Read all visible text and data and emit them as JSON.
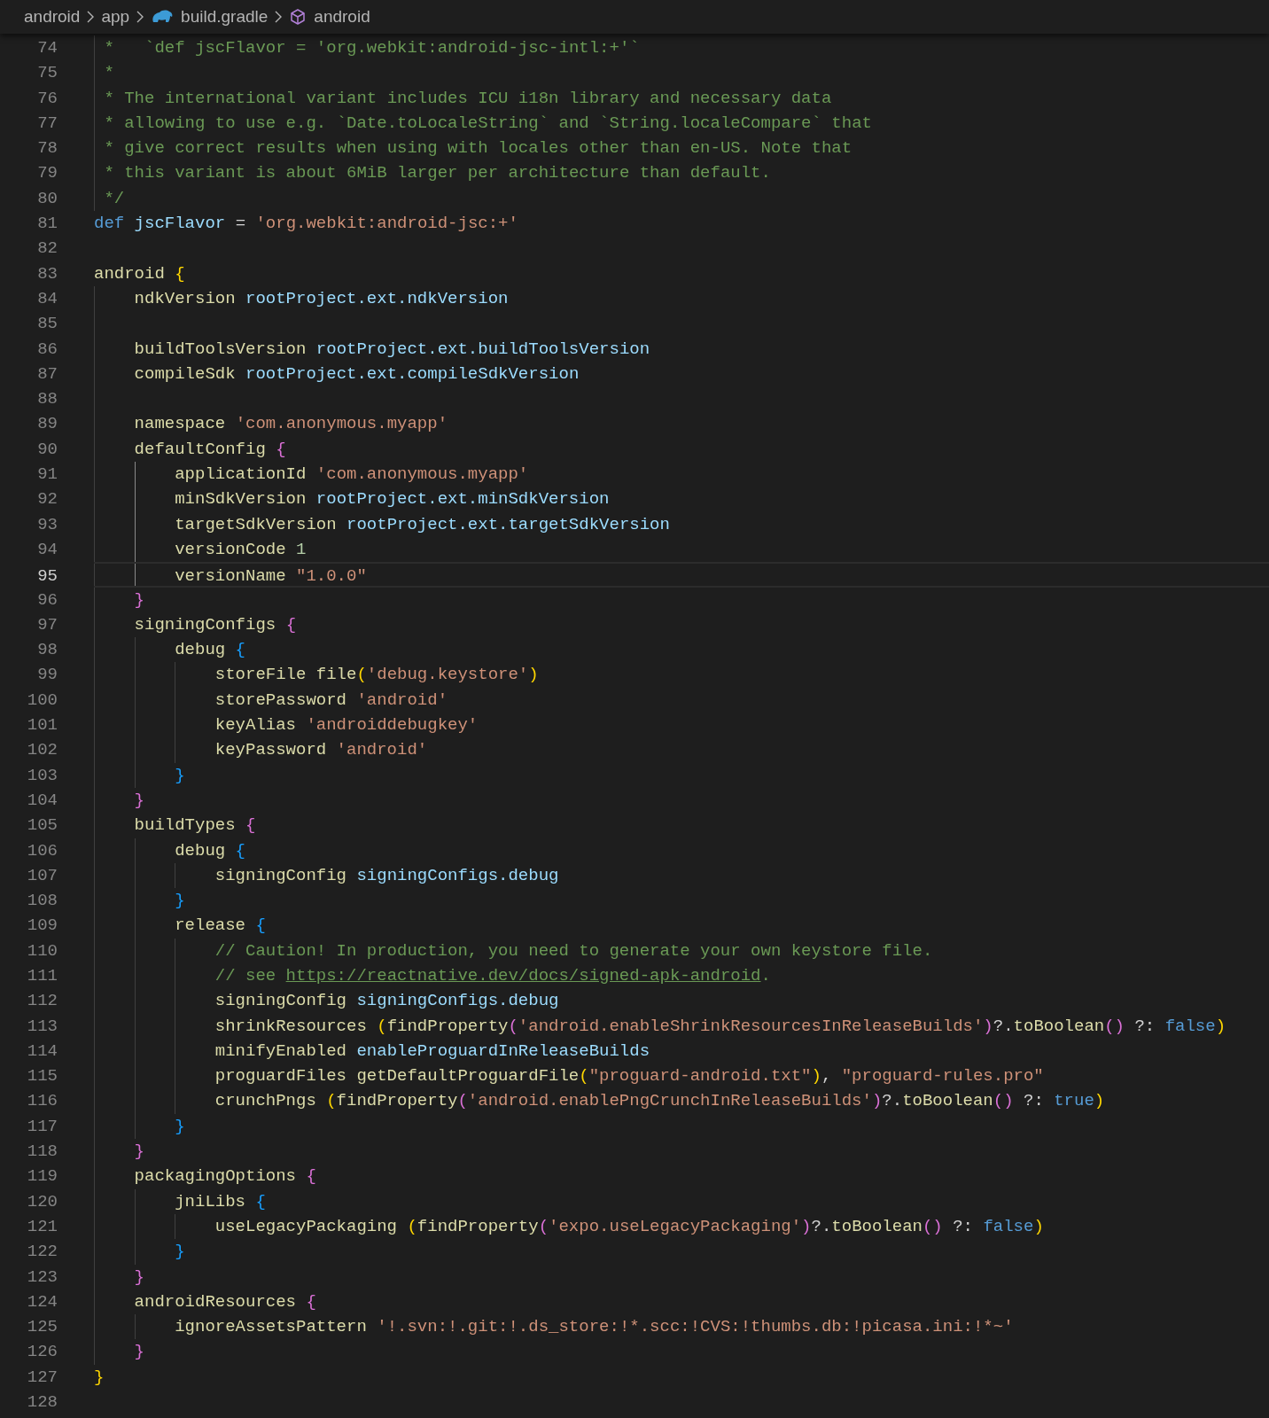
{
  "breadcrumb": [
    {
      "text": "android",
      "kind": "folder"
    },
    {
      "text": "app",
      "kind": "folder"
    },
    {
      "text": "build.gradle",
      "kind": "file"
    },
    {
      "text": "android",
      "kind": "symbol"
    }
  ],
  "lines": [
    {
      "number": "74",
      "kind": "doc",
      "guides": [
        false
      ],
      "current": false,
      "tokens": [
        {
          "kind": "cmt",
          "text": "*   `def jscFlavor = 'org.webkit:android-jsc-intl:+'`"
        }
      ]
    },
    {
      "number": "75",
      "kind": "doc",
      "guides": [
        false
      ],
      "current": false,
      "tokens": [
        {
          "kind": "cmt",
          "text": "*"
        }
      ]
    },
    {
      "number": "76",
      "kind": "doc",
      "guides": [
        false
      ],
      "current": false,
      "tokens": [
        {
          "kind": "cmt",
          "text": "* The international variant includes ICU i18n library and necessary data"
        }
      ]
    },
    {
      "number": "77",
      "kind": "doc",
      "guides": [
        false
      ],
      "current": false,
      "tokens": [
        {
          "kind": "cmt",
          "text": "* allowing to use e.g. `Date.toLocaleString` and `String.localeCompare` that"
        }
      ]
    },
    {
      "number": "78",
      "kind": "doc",
      "guides": [
        false
      ],
      "current": false,
      "tokens": [
        {
          "kind": "cmt",
          "text": "* give correct results when using with locales other than en-US. Note that"
        }
      ]
    },
    {
      "number": "79",
      "kind": "doc",
      "guides": [
        false
      ],
      "current": false,
      "tokens": [
        {
          "kind": "cmt",
          "text": "* this variant is about 6MiB larger per architecture than default."
        }
      ]
    },
    {
      "number": "80",
      "kind": "doc",
      "guides": [
        false
      ],
      "current": false,
      "tokens": [
        {
          "kind": "cmt",
          "text": "*/"
        }
      ]
    },
    {
      "number": "81",
      "kind": "code",
      "current": false,
      "tokens": [
        {
          "kind": "kw",
          "text": "def "
        },
        {
          "kind": "var",
          "text": "jscFlavor"
        },
        {
          "kind": "plain",
          "text": " = "
        },
        {
          "kind": "str",
          "text": "'org.webkit:android-jsc:+'"
        }
      ]
    },
    {
      "number": "82",
      "kind": "code",
      "current": false
    },
    {
      "number": "83",
      "kind": "code",
      "current": false,
      "tokens": [
        {
          "kind": "fn",
          "text": "android "
        },
        {
          "kind": "b0",
          "text": "{"
        }
      ]
    },
    {
      "number": "84",
      "kind": "code",
      "guides": [
        false
      ],
      "current": false,
      "tokens": [
        {
          "kind": "fn",
          "text": "ndkVersion "
        },
        {
          "kind": "var",
          "text": "rootProject.ext.ndkVersion"
        }
      ]
    },
    {
      "number": "85",
      "kind": "code",
      "guides": [
        false
      ],
      "current": false
    },
    {
      "number": "86",
      "kind": "code",
      "guides": [
        false
      ],
      "current": false,
      "tokens": [
        {
          "kind": "fn",
          "text": "buildToolsVersion "
        },
        {
          "kind": "var",
          "text": "rootProject.ext.buildToolsVersion"
        }
      ]
    },
    {
      "number": "87",
      "kind": "code",
      "guides": [
        false
      ],
      "current": false,
      "tokens": [
        {
          "kind": "fn",
          "text": "compileSdk "
        },
        {
          "kind": "var",
          "text": "rootProject.ext.compileSdkVersion"
        }
      ]
    },
    {
      "number": "88",
      "kind": "code",
      "guides": [
        false
      ],
      "current": false
    },
    {
      "number": "89",
      "kind": "code",
      "guides": [
        false
      ],
      "current": false,
      "tokens": [
        {
          "kind": "fn",
          "text": "namespace "
        },
        {
          "kind": "str",
          "text": "'com.anonymous.myapp'"
        }
      ]
    },
    {
      "number": "90",
      "kind": "code",
      "guides": [
        false
      ],
      "current": false,
      "tokens": [
        {
          "kind": "fn",
          "text": "defaultConfig "
        },
        {
          "kind": "b1",
          "text": "{"
        }
      ]
    },
    {
      "number": "91",
      "kind": "code",
      "guides": [
        false,
        true
      ],
      "current": false,
      "tokens": [
        {
          "kind": "fn",
          "text": "applicationId "
        },
        {
          "kind": "str",
          "text": "'com.anonymous.myapp'"
        }
      ]
    },
    {
      "number": "92",
      "kind": "code",
      "guides": [
        false,
        true
      ],
      "current": false,
      "tokens": [
        {
          "kind": "fn",
          "text": "minSdkVersion "
        },
        {
          "kind": "var",
          "text": "rootProject.ext.minSdkVersion"
        }
      ]
    },
    {
      "number": "93",
      "kind": "code",
      "guides": [
        false,
        true
      ],
      "current": false,
      "tokens": [
        {
          "kind": "fn",
          "text": "targetSdkVersion "
        },
        {
          "kind": "var",
          "text": "rootProject.ext.targetSdkVersion"
        }
      ]
    },
    {
      "number": "94",
      "kind": "code",
      "guides": [
        false,
        true
      ],
      "current": false,
      "tokens": [
        {
          "kind": "fn",
          "text": "versionCode "
        },
        {
          "kind": "num",
          "text": "1"
        }
      ]
    },
    {
      "number": "95",
      "kind": "code",
      "guides": [
        false,
        true
      ],
      "current": true,
      "tokens": [
        {
          "kind": "fn",
          "text": "versionName "
        },
        {
          "kind": "str",
          "text": "\"1.0.0\""
        }
      ]
    },
    {
      "number": "96",
      "kind": "code",
      "guides": [
        false
      ],
      "current": false,
      "tokens": [
        {
          "kind": "b1",
          "text": "}"
        }
      ]
    },
    {
      "number": "97",
      "kind": "code",
      "guides": [
        false
      ],
      "current": false,
      "tokens": [
        {
          "kind": "fn",
          "text": "signingConfigs "
        },
        {
          "kind": "b1",
          "text": "{"
        }
      ]
    },
    {
      "number": "98",
      "kind": "code",
      "guides": [
        false,
        false
      ],
      "current": false,
      "tokens": [
        {
          "kind": "fn",
          "text": "debug "
        },
        {
          "kind": "b2",
          "text": "{"
        }
      ]
    },
    {
      "number": "99",
      "kind": "code",
      "guides": [
        false,
        false,
        false
      ],
      "current": false,
      "tokens": [
        {
          "kind": "fn",
          "text": "storeFile file"
        },
        {
          "kind": "b0",
          "text": "("
        },
        {
          "kind": "str",
          "text": "'debug.keystore'"
        },
        {
          "kind": "b0",
          "text": ")"
        }
      ]
    },
    {
      "number": "100",
      "kind": "code",
      "guides": [
        false,
        false,
        false
      ],
      "current": false,
      "tokens": [
        {
          "kind": "fn",
          "text": "storePassword "
        },
        {
          "kind": "str",
          "text": "'android'"
        }
      ]
    },
    {
      "number": "101",
      "kind": "code",
      "guides": [
        false,
        false,
        false
      ],
      "current": false,
      "tokens": [
        {
          "kind": "fn",
          "text": "keyAlias "
        },
        {
          "kind": "str",
          "text": "'androiddebugkey'"
        }
      ]
    },
    {
      "number": "102",
      "kind": "code",
      "guides": [
        false,
        false,
        false
      ],
      "current": false,
      "tokens": [
        {
          "kind": "fn",
          "text": "keyPassword "
        },
        {
          "kind": "str",
          "text": "'android'"
        }
      ]
    },
    {
      "number": "103",
      "kind": "code",
      "guides": [
        false,
        false
      ],
      "current": false,
      "tokens": [
        {
          "kind": "b2",
          "text": "}"
        }
      ]
    },
    {
      "number": "104",
      "kind": "code",
      "guides": [
        false
      ],
      "current": false,
      "tokens": [
        {
          "kind": "b1",
          "text": "}"
        }
      ]
    },
    {
      "number": "105",
      "kind": "code",
      "guides": [
        false
      ],
      "current": false,
      "tokens": [
        {
          "kind": "fn",
          "text": "buildTypes "
        },
        {
          "kind": "b1",
          "text": "{"
        }
      ]
    },
    {
      "number": "106",
      "kind": "code",
      "guides": [
        false,
        false
      ],
      "current": false,
      "tokens": [
        {
          "kind": "fn",
          "text": "debug "
        },
        {
          "kind": "b2",
          "text": "{"
        }
      ]
    },
    {
      "number": "107",
      "kind": "code",
      "guides": [
        false,
        false,
        false
      ],
      "current": false,
      "tokens": [
        {
          "kind": "fn",
          "text": "signingConfig "
        },
        {
          "kind": "var",
          "text": "signingConfigs.debug"
        }
      ]
    },
    {
      "number": "108",
      "kind": "code",
      "guides": [
        false,
        false
      ],
      "current": false,
      "tokens": [
        {
          "kind": "b2",
          "text": "}"
        }
      ]
    },
    {
      "number": "109",
      "kind": "code",
      "guides": [
        false,
        false
      ],
      "current": false,
      "tokens": [
        {
          "kind": "fn",
          "text": "release "
        },
        {
          "kind": "b2",
          "text": "{"
        }
      ]
    },
    {
      "number": "110",
      "kind": "code",
      "guides": [
        false,
        false,
        false
      ],
      "current": false,
      "tokens": [
        {
          "kind": "cmt",
          "text": "// Caution! In production, you need to generate your own keystore file."
        }
      ]
    },
    {
      "number": "111",
      "kind": "code",
      "guides": [
        false,
        false,
        false
      ],
      "current": false,
      "tokens": [
        {
          "kind": "cmt",
          "text": "// see "
        },
        {
          "kind": "link",
          "text": "https://reactnative.dev/docs/signed-apk-android"
        },
        {
          "kind": "cmt",
          "text": "."
        }
      ]
    },
    {
      "number": "112",
      "kind": "code",
      "guides": [
        false,
        false,
        false
      ],
      "current": false,
      "tokens": [
        {
          "kind": "fn",
          "text": "signingConfig "
        },
        {
          "kind": "var",
          "text": "signingConfigs.debug"
        }
      ]
    },
    {
      "number": "113",
      "kind": "code",
      "guides": [
        false,
        false,
        false
      ],
      "current": false,
      "tokens": [
        {
          "kind": "fn",
          "text": "shrinkResources "
        },
        {
          "kind": "b0",
          "text": "("
        },
        {
          "kind": "fn",
          "text": "findProperty"
        },
        {
          "kind": "b1",
          "text": "("
        },
        {
          "kind": "str",
          "text": "'android.enableShrinkResourcesInReleaseBuilds'"
        },
        {
          "kind": "b1",
          "text": ")"
        },
        {
          "kind": "plain",
          "text": "?."
        },
        {
          "kind": "fn",
          "text": "toBoolean"
        },
        {
          "kind": "b1",
          "text": "()"
        },
        {
          "kind": "plain",
          "text": " ?: "
        },
        {
          "kind": "kw",
          "text": "false"
        },
        {
          "kind": "b0",
          "text": ")"
        }
      ]
    },
    {
      "number": "114",
      "kind": "code",
      "guides": [
        false,
        false,
        false
      ],
      "current": false,
      "tokens": [
        {
          "kind": "fn",
          "text": "minifyEnabled "
        },
        {
          "kind": "var",
          "text": "enableProguardInReleaseBuilds"
        }
      ]
    },
    {
      "number": "115",
      "kind": "code",
      "guides": [
        false,
        false,
        false
      ],
      "current": false,
      "tokens": [
        {
          "kind": "fn",
          "text": "proguardFiles getDefaultProguardFile"
        },
        {
          "kind": "b0",
          "text": "("
        },
        {
          "kind": "str",
          "text": "\"proguard-android.txt\""
        },
        {
          "kind": "b0",
          "text": ")"
        },
        {
          "kind": "plain",
          "text": ", "
        },
        {
          "kind": "str",
          "text": "\"proguard-rules.pro\""
        }
      ]
    },
    {
      "number": "116",
      "kind": "code",
      "guides": [
        false,
        false,
        false
      ],
      "current": false,
      "tokens": [
        {
          "kind": "fn",
          "text": "crunchPngs "
        },
        {
          "kind": "b0",
          "text": "("
        },
        {
          "kind": "fn",
          "text": "findProperty"
        },
        {
          "kind": "b1",
          "text": "("
        },
        {
          "kind": "str",
          "text": "'android.enablePngCrunchInReleaseBuilds'"
        },
        {
          "kind": "b1",
          "text": ")"
        },
        {
          "kind": "plain",
          "text": "?."
        },
        {
          "kind": "fn",
          "text": "toBoolean"
        },
        {
          "kind": "b1",
          "text": "()"
        },
        {
          "kind": "plain",
          "text": " ?: "
        },
        {
          "kind": "kw",
          "text": "true"
        },
        {
          "kind": "b0",
          "text": ")"
        }
      ]
    },
    {
      "number": "117",
      "kind": "code",
      "guides": [
        false,
        false
      ],
      "current": false,
      "tokens": [
        {
          "kind": "b2",
          "text": "}"
        }
      ]
    },
    {
      "number": "118",
      "kind": "code",
      "guides": [
        false
      ],
      "current": false,
      "tokens": [
        {
          "kind": "b1",
          "text": "}"
        }
      ]
    },
    {
      "number": "119",
      "kind": "code",
      "guides": [
        false
      ],
      "current": false,
      "tokens": [
        {
          "kind": "fn",
          "text": "packagingOptions "
        },
        {
          "kind": "b1",
          "text": "{"
        }
      ]
    },
    {
      "number": "120",
      "kind": "code",
      "guides": [
        false,
        false
      ],
      "current": false,
      "tokens": [
        {
          "kind": "fn",
          "text": "jniLibs "
        },
        {
          "kind": "b2",
          "text": "{"
        }
      ]
    },
    {
      "number": "121",
      "kind": "code",
      "guides": [
        false,
        false,
        false
      ],
      "current": false,
      "tokens": [
        {
          "kind": "fn",
          "text": "useLegacyPackaging "
        },
        {
          "kind": "b0",
          "text": "("
        },
        {
          "kind": "fn",
          "text": "findProperty"
        },
        {
          "kind": "b1",
          "text": "("
        },
        {
          "kind": "str",
          "text": "'expo.useLegacyPackaging'"
        },
        {
          "kind": "b1",
          "text": ")"
        },
        {
          "kind": "plain",
          "text": "?."
        },
        {
          "kind": "fn",
          "text": "toBoolean"
        },
        {
          "kind": "b1",
          "text": "()"
        },
        {
          "kind": "plain",
          "text": " ?: "
        },
        {
          "kind": "kw",
          "text": "false"
        },
        {
          "kind": "b0",
          "text": ")"
        }
      ]
    },
    {
      "number": "122",
      "kind": "code",
      "guides": [
        false,
        false
      ],
      "current": false,
      "tokens": [
        {
          "kind": "b2",
          "text": "}"
        }
      ]
    },
    {
      "number": "123",
      "kind": "code",
      "guides": [
        false
      ],
      "current": false,
      "tokens": [
        {
          "kind": "b1",
          "text": "}"
        }
      ]
    },
    {
      "number": "124",
      "kind": "code",
      "guides": [
        false
      ],
      "current": false,
      "tokens": [
        {
          "kind": "fn",
          "text": "androidResources "
        },
        {
          "kind": "b1",
          "text": "{"
        }
      ]
    },
    {
      "number": "125",
      "kind": "code",
      "guides": [
        false,
        false
      ],
      "current": false,
      "tokens": [
        {
          "kind": "fn",
          "text": "ignoreAssetsPattern "
        },
        {
          "kind": "str",
          "text": "'!.svn:!.git:!.ds_store:!*.scc:!CVS:!thumbs.db:!picasa.ini:!*~'"
        }
      ]
    },
    {
      "number": "126",
      "kind": "code",
      "guides": [
        false
      ],
      "current": false,
      "tokens": [
        {
          "kind": "b1",
          "text": "}"
        }
      ]
    },
    {
      "number": "127",
      "kind": "code",
      "current": false,
      "tokens": [
        {
          "kind": "b0",
          "text": "}"
        }
      ]
    },
    {
      "number": "128",
      "kind": "code",
      "current": false
    }
  ]
}
